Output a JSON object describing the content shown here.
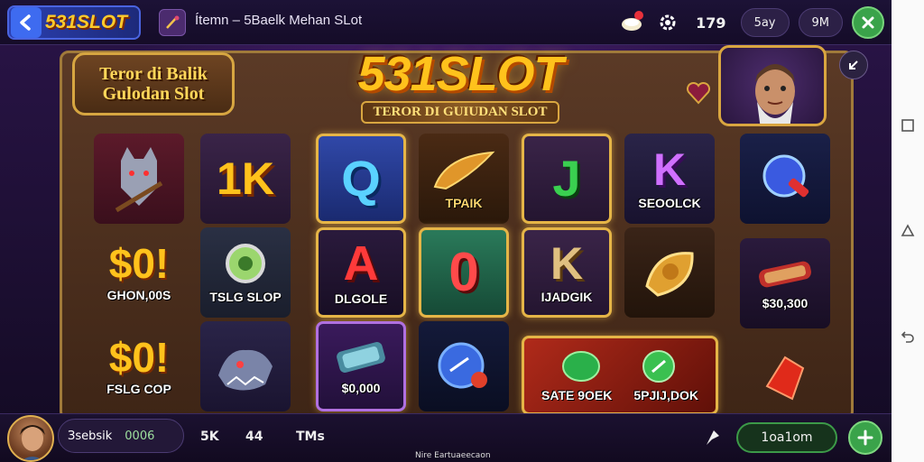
{
  "header": {
    "brand": "531SLOT",
    "game_title": "Ítemn – 5Baelk  Mehan SLot",
    "count": "179",
    "pill_1": "5ay",
    "pill_2": "9M"
  },
  "board": {
    "side_title_line1": "Teror di Balik",
    "side_title_line2": "Gulodan Slot",
    "logo": "531SLOT",
    "logo_sub": "TEROR DI GUIUDAN SLOT"
  },
  "reels": {
    "col0": [
      {
        "symbol": "",
        "label": ""
      },
      {
        "symbol": "$0!",
        "label": "GHON,00S"
      },
      {
        "symbol": "$0!",
        "label": "FSLG COP"
      }
    ],
    "col1": [
      {
        "symbol": "1K",
        "label": ""
      },
      {
        "symbol": "",
        "label": "TSLG SLOP"
      },
      {
        "symbol": "",
        "label": ""
      }
    ],
    "col2": [
      {
        "symbol": "Q",
        "label": ""
      },
      {
        "symbol": "A",
        "label": "DLGOLE"
      },
      {
        "symbol": "",
        "label": "$0,000"
      }
    ],
    "col3": [
      {
        "symbol": "",
        "label": "TPAIK"
      },
      {
        "symbol": "0",
        "label": ""
      },
      {
        "symbol": "",
        "label": ""
      }
    ],
    "col4": [
      {
        "symbol": "J",
        "label": ""
      },
      {
        "symbol": "K",
        "label": "IJADGIK"
      },
      {
        "symbol": "",
        "label": "SATE 9OEK"
      }
    ],
    "col5": [
      {
        "symbol": "K",
        "label": "SEOOLCK"
      },
      {
        "symbol": "",
        "label": ""
      },
      {
        "symbol": "",
        "label": "5PJIJ,DOK"
      }
    ],
    "col6": [
      {
        "symbol": "",
        "label": ""
      },
      {
        "symbol": "",
        "label": "$30,300"
      },
      {
        "symbol": "",
        "label": ""
      }
    ]
  },
  "footer": {
    "player_name": "Зsebsik",
    "player_value": "0006",
    "stat_1": "5K",
    "stat_2": "44",
    "stat_3": "TMs",
    "caption": "Nire Eartuaeecaon",
    "action_label": "1oa1om"
  },
  "colors": {
    "accent_gold": "#ffc21c",
    "accent_green": "#3aa34a",
    "bg_purple": "#2a1448"
  }
}
